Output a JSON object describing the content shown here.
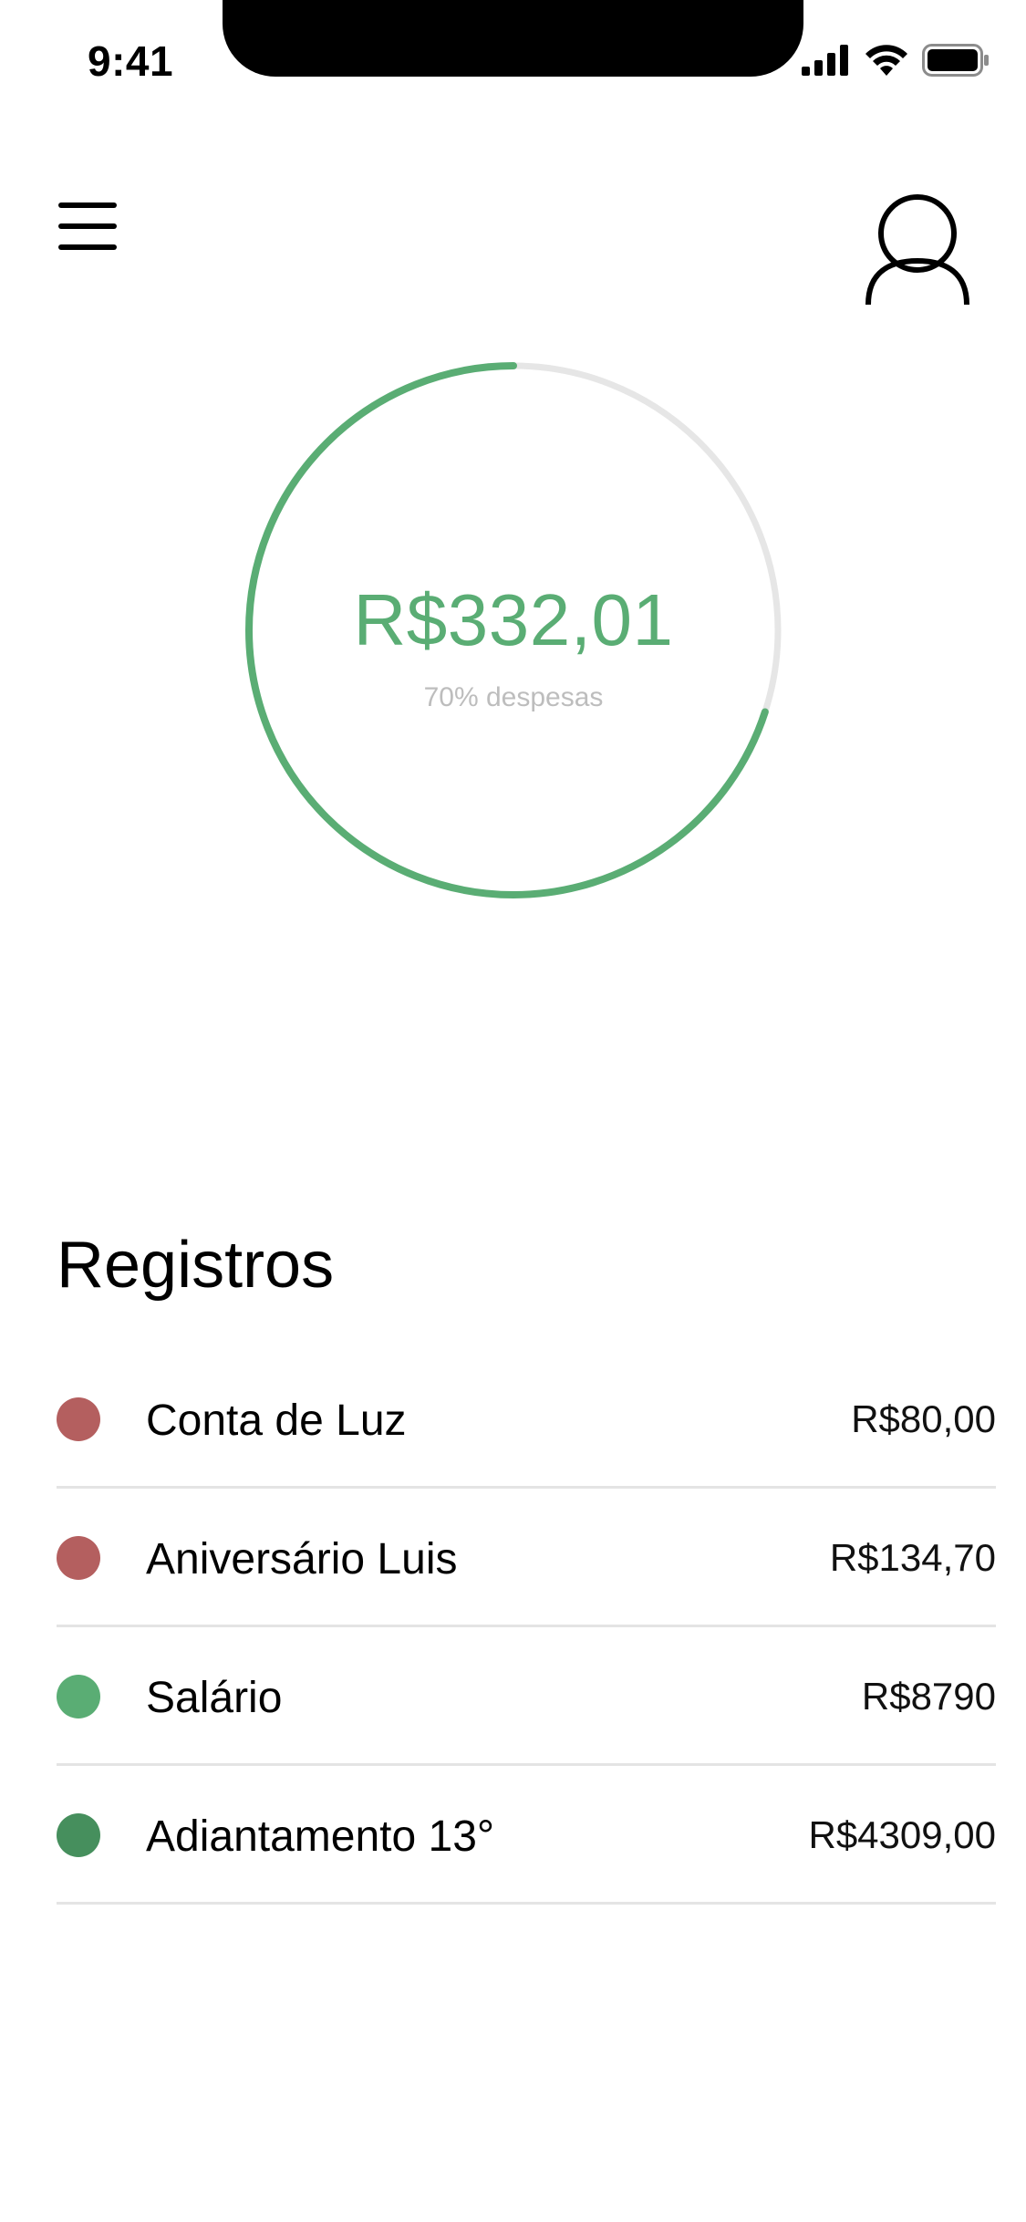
{
  "status_bar": {
    "time": "9:41",
    "icons": [
      "cellular-signal-icon",
      "wifi-icon",
      "battery-icon"
    ]
  },
  "header": {
    "menu_icon": "hamburger-menu-icon",
    "profile_icon": "user-profile-icon"
  },
  "balance": {
    "amount": "R$332,01",
    "subtitle": "70% despesas",
    "ring_progress": 0.7,
    "ring_color": "#5aad74",
    "ring_track_color": "#e6e6e6"
  },
  "records": {
    "title": "Registros",
    "items": [
      {
        "name": "Conta de Luz",
        "value": "R$80,00",
        "color": "#b45f5f"
      },
      {
        "name": "Aniversário Luis",
        "value": "R$134,70",
        "color": "#b45f5f"
      },
      {
        "name": "Salário",
        "value": "R$8790",
        "color": "#5aad74"
      },
      {
        "name": "Adiantamento 13°",
        "value": "R$4309,00",
        "color": "#468f5d"
      }
    ]
  }
}
